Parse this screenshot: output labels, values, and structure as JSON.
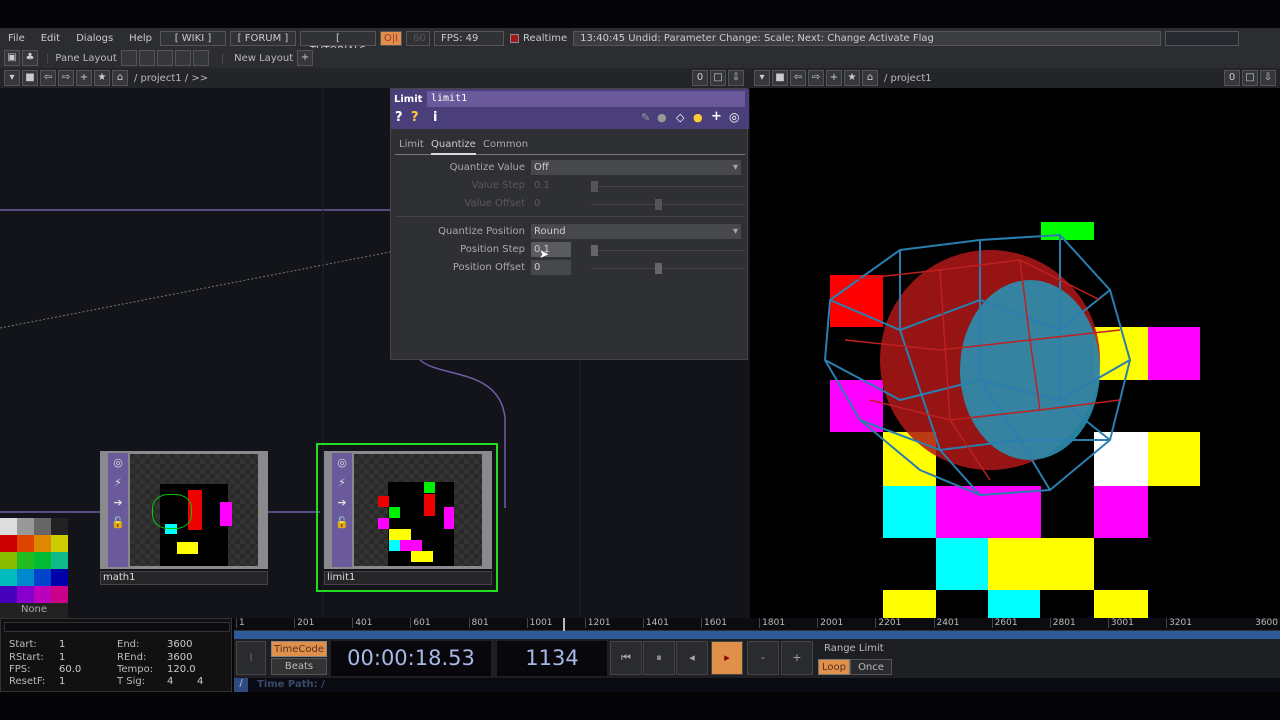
{
  "menu": {
    "items": [
      "File",
      "Edit",
      "Dialogs",
      "Help"
    ],
    "wiki": "[ WIKI ]",
    "forum": "[ FORUM ]",
    "tutorials": "[ TUTORIALS ]",
    "oi": "O|I",
    "sixty": "60",
    "fps": "FPS:  49",
    "realtime": "Realtime",
    "status": "13:40:45 Undid: Parameter Change: Scale; Next: Change Activate Flag"
  },
  "pane": {
    "label": "Pane Layout",
    "new_layout": "New Layout",
    "plus": "+"
  },
  "path_left": {
    "path": "/ project1 / >>",
    "zero": "0"
  },
  "path_right": {
    "path": "/ project1",
    "zero": "0"
  },
  "param": {
    "type": "Limit",
    "name": "limit1",
    "tabs": [
      "Limit",
      "Quantize",
      "Common"
    ],
    "active_tab": "Quantize",
    "rows": [
      {
        "label": "Quantize Value",
        "value": "Off"
      },
      {
        "label": "Value Step",
        "value": "0.1",
        "slider": 0.1
      },
      {
        "label": "Value Offset",
        "value": "0",
        "slider": 0.5
      },
      {
        "label": "Quantize Position",
        "value": "Round"
      },
      {
        "label": "Position Step",
        "value": "0.1",
        "slider": 0.1
      },
      {
        "label": "Position Offset",
        "value": "0",
        "slider": 0.5
      }
    ]
  },
  "nodes": [
    {
      "name": "math1"
    },
    {
      "name": "limit1",
      "selected": true
    }
  ],
  "palette": {
    "none": "None"
  },
  "timeinfo": {
    "start_l": "Start:",
    "start": "1",
    "end_l": "End:",
    "end": "3600",
    "rstart_l": "RStart:",
    "rstart": "1",
    "rend_l": "REnd:",
    "rend": "3600",
    "fps_l": "FPS:",
    "fps": "60.0",
    "tempo_l": "Tempo:",
    "tempo": "120.0",
    "resetf_l": "ResetF:",
    "resetf": "1",
    "tsig_l": "T Sig:",
    "tsig1": "4",
    "tsig2": "4"
  },
  "timeline": {
    "ticks": [
      "1",
      "201",
      "401",
      "601",
      "801",
      "1001",
      "1201",
      "1401",
      "1601",
      "1801",
      "2001",
      "2201",
      "2401",
      "2601",
      "2801",
      "3001",
      "3201",
      "3600"
    ],
    "current_frame": 1134,
    "range_end": 3600
  },
  "transport": {
    "timecode_btn": "TimeCode",
    "beats_btn": "Beats",
    "timecode": "00:00:18.53",
    "frame": "1134",
    "range_limit": "Range Limit",
    "loop": "Loop",
    "once": "Once",
    "time_path": "Time Path: /",
    "slash": "/",
    "i_btn": "I"
  },
  "colors": {
    "accent": "#e0904a",
    "selected": "#22dd22",
    "node": "#6a5a9c"
  }
}
